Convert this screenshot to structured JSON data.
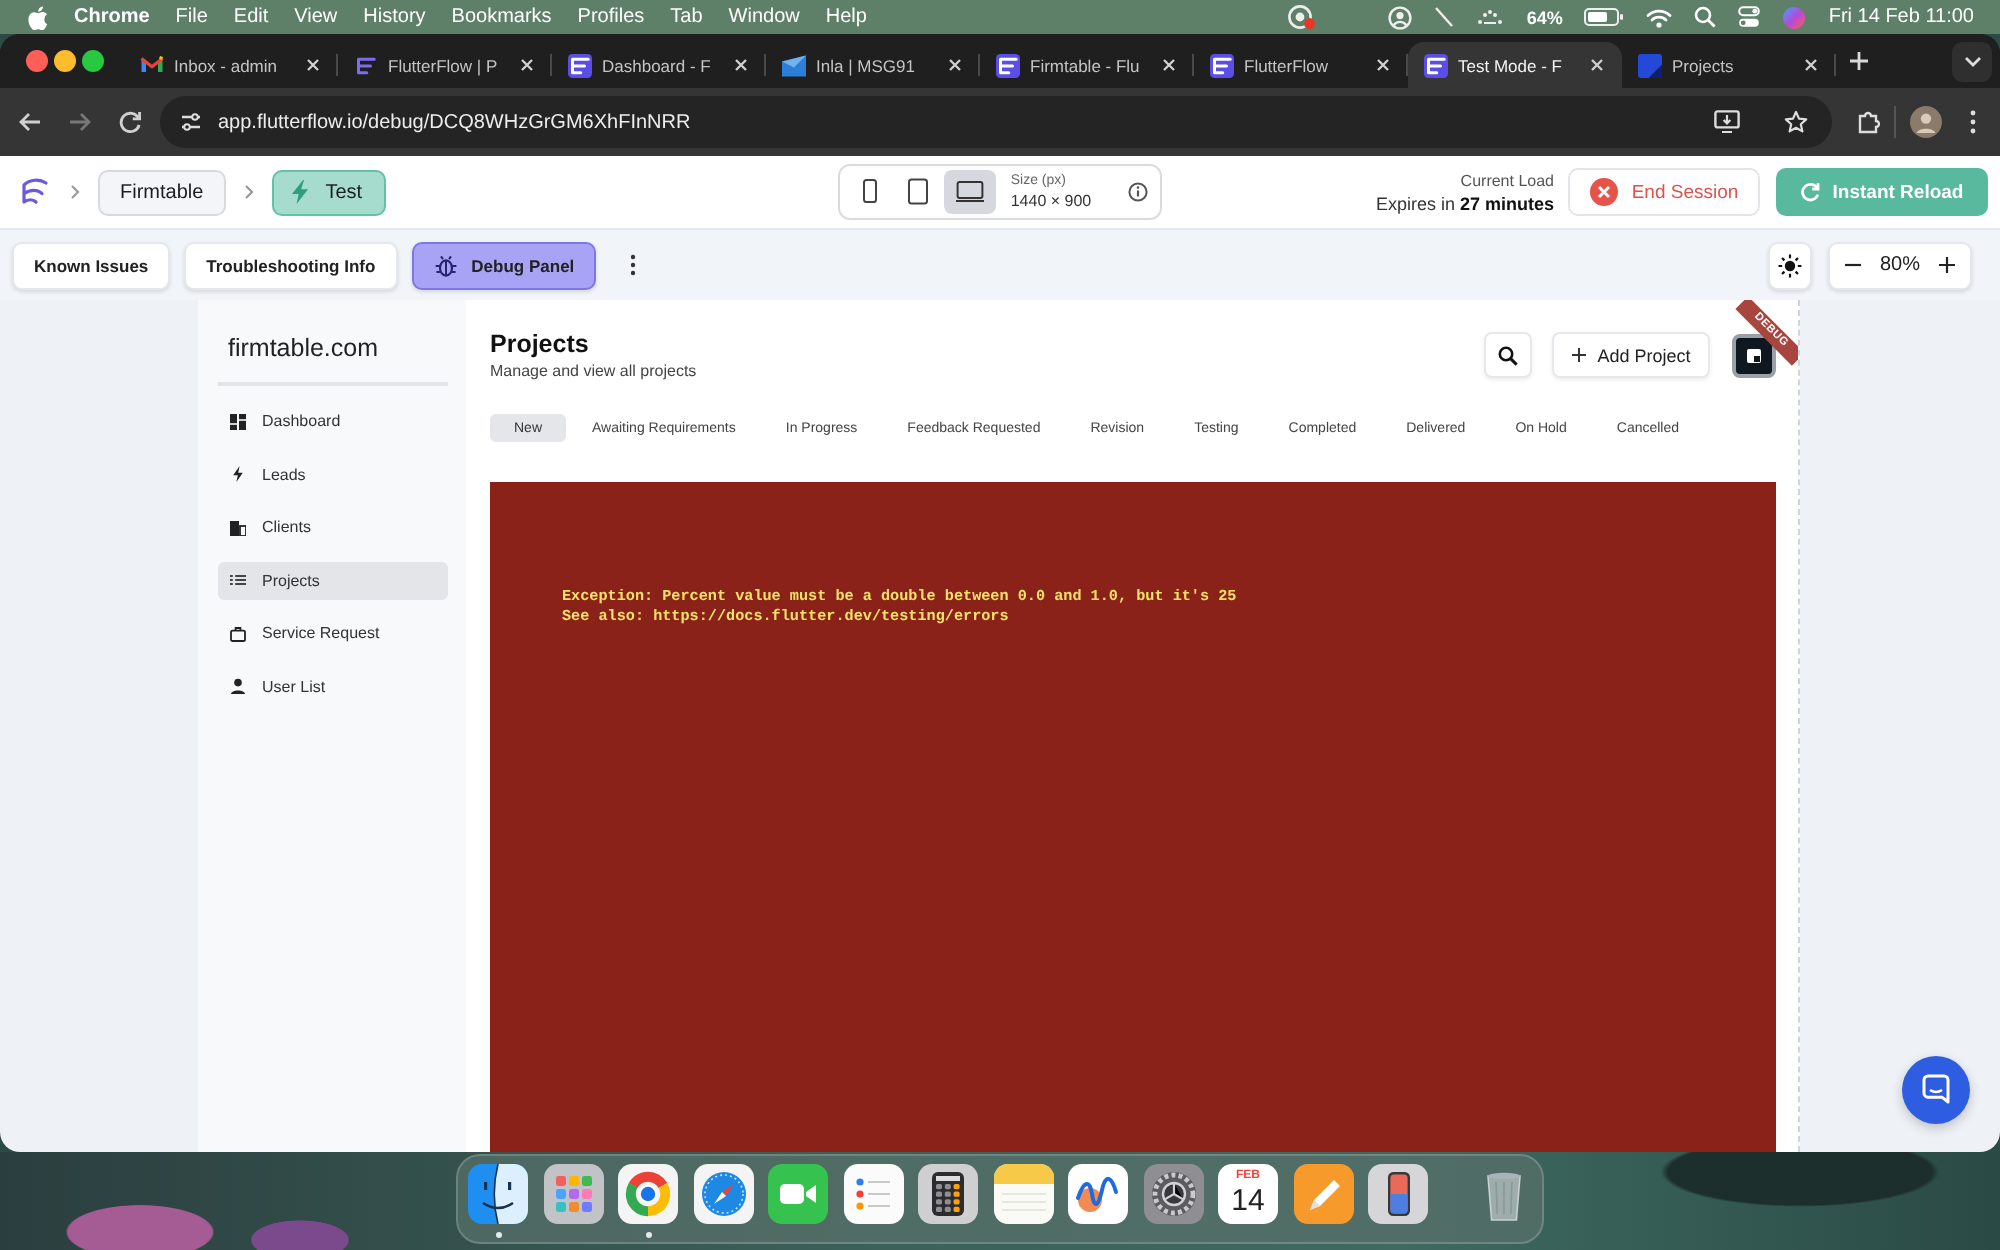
{
  "menu_bar": {
    "app": "Chrome",
    "items": [
      "File",
      "Edit",
      "View",
      "History",
      "Bookmarks",
      "Profiles",
      "Tab",
      "Window",
      "Help"
    ],
    "battery": "64%",
    "clock": "Fri 14 Feb 11:00"
  },
  "browser": {
    "tabs": [
      {
        "title": "Inbox - admin",
        "selected": false
      },
      {
        "title": "FlutterFlow | P",
        "selected": false
      },
      {
        "title": "Dashboard - F",
        "selected": false
      },
      {
        "title": "Inla | MSG91",
        "selected": false
      },
      {
        "title": "Firmtable - Flu",
        "selected": false
      },
      {
        "title": "FlutterFlow",
        "selected": false
      },
      {
        "title": "Test Mode - F",
        "selected": true
      },
      {
        "title": "Projects",
        "selected": false
      }
    ],
    "url": "app.flutterflow.io/debug/DCQ8WHzGrGM6XhFInNRR"
  },
  "test_toolbar": {
    "project": "Firmtable",
    "mode": "Test",
    "devices": [
      {
        "selected": false
      },
      {
        "selected": false
      },
      {
        "selected": true
      }
    ],
    "size_label": "Size (px)",
    "size": "1440 × 900",
    "load_label": "Current Load",
    "expires": "Expires in **27 minutes**",
    "end_session": "End Session",
    "instant_reload": "Instant Reload"
  },
  "debug_bar": {
    "buttons": [
      {
        "label": "Known Issues",
        "selected": false
      },
      {
        "label": "Troubleshooting Info",
        "selected": false
      },
      {
        "label": "Debug Panel",
        "selected": true
      }
    ],
    "zoom": "80%"
  },
  "app": {
    "brand": "firmtable.com",
    "nav": [
      {
        "label": "Dashboard",
        "selected": false
      },
      {
        "label": "Leads",
        "selected": false
      },
      {
        "label": "Clients",
        "selected": false
      },
      {
        "label": "Projects",
        "selected": true
      },
      {
        "label": "Service Request",
        "selected": false
      },
      {
        "label": "User List",
        "selected": false
      }
    ],
    "title": "Projects",
    "subtitle": "Manage and view all projects",
    "add_button": "Add Project",
    "debug_banner": "DEBUG",
    "status_tabs": [
      {
        "label": "New",
        "selected": true
      },
      {
        "label": "Awaiting Requirements",
        "selected": false
      },
      {
        "label": "In Progress",
        "selected": false
      },
      {
        "label": "Feedback Requested",
        "selected": false
      },
      {
        "label": "Revision",
        "selected": false
      },
      {
        "label": "Testing",
        "selected": false
      },
      {
        "label": "Completed",
        "selected": false
      },
      {
        "label": "Delivered",
        "selected": false
      },
      {
        "label": "On Hold",
        "selected": false
      },
      {
        "label": "Cancelled",
        "selected": false
      }
    ],
    "error_lines": [
      "Exception: Percent value must be a double between 0.0 and 1.0, but it's 25",
      "See also: https://docs.flutter.dev/testing/errors"
    ]
  },
  "dock": {
    "apps": [
      {
        "running": true
      },
      {
        "running": false
      },
      {
        "running": true
      },
      {
        "running": false
      },
      {
        "running": false
      },
      {
        "running": false
      },
      {
        "running": false
      },
      {
        "running": false
      },
      {
        "running": false
      },
      {
        "running": false
      },
      {
        "running": false,
        "month": "FEB",
        "day": "14"
      },
      {
        "running": false
      },
      {
        "running": false
      }
    ]
  }
}
